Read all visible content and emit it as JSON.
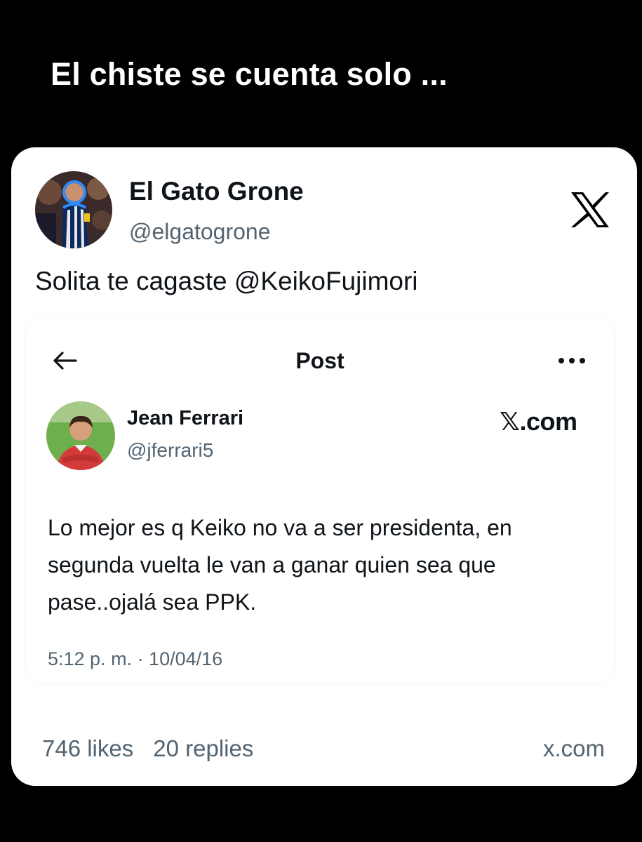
{
  "caption": "El chiste se cuenta solo ...",
  "outer_tweet": {
    "author_name": "El Gato Grone",
    "author_handle": "@elgatogrone",
    "text": "Solita te cagaste @KeikoFujimori",
    "platform_icon": "x-logo-icon"
  },
  "embedded_post": {
    "header_title": "Post",
    "back_icon": "arrow-left-icon",
    "more_icon": "more-horizontal-icon",
    "author_name": "Jean Ferrari",
    "author_handle": "@jferrari5",
    "platform_mark": "𝕏.com",
    "text": "Lo mejor es q Keiko no va a ser presidenta, en segunda vuelta le van a ganar quien sea que pase..ojalá sea PPK.",
    "timestamp": "5:12 p. m. · 10/04/16"
  },
  "footer": {
    "likes": "746 likes",
    "replies": "20 replies",
    "source": "x.com"
  },
  "colors": {
    "background": "#000000",
    "card": "#ffffff",
    "text_primary": "#0f1419",
    "text_secondary": "#536471"
  }
}
